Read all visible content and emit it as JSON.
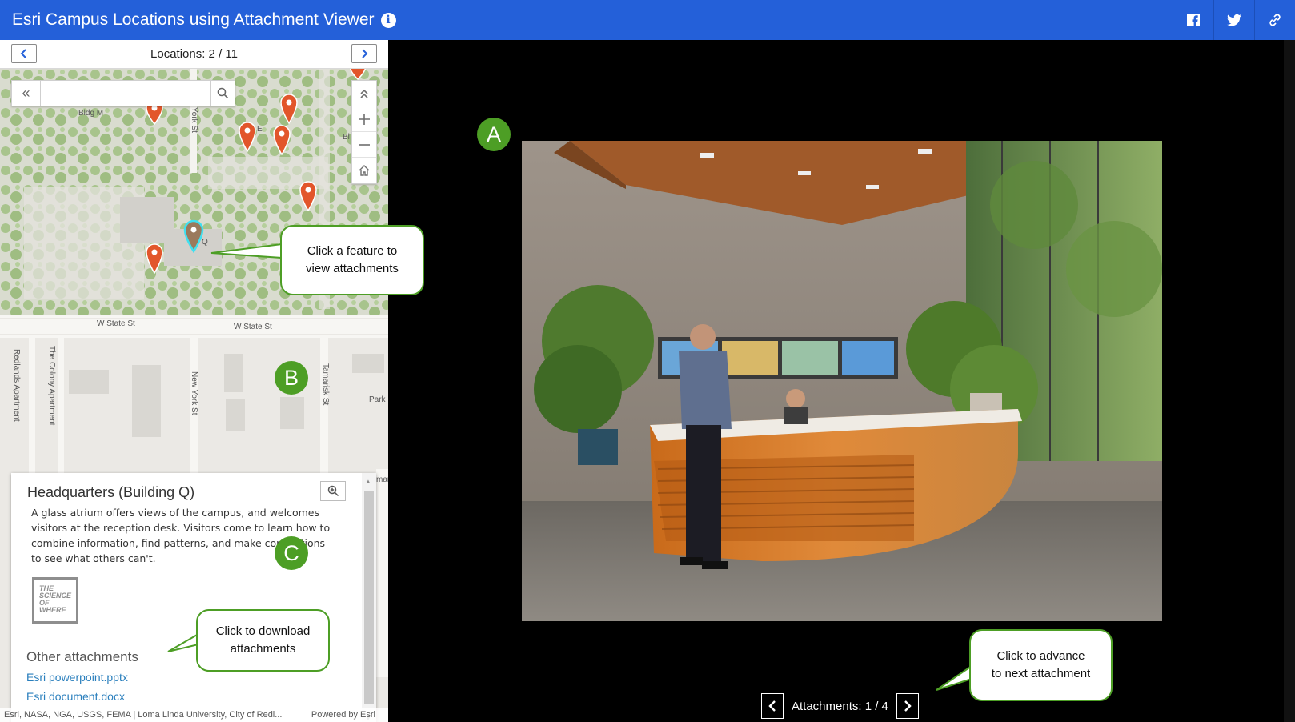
{
  "header": {
    "title": "Esri Campus Locations using Attachment Viewer",
    "bg_color": "#2460d9",
    "share_icons": [
      "facebook-icon",
      "twitter-icon",
      "link-icon"
    ]
  },
  "locations": {
    "label": "Locations: 2 / 11"
  },
  "map": {
    "search_placeholder": "",
    "labels": {
      "bldg_m": "Bldg M",
      "york_st": "York St",
      "bldg_e": "E",
      "bldg_bl": "Bl",
      "bldg_q": "Q",
      "w_state_1": "W State St",
      "w_state_2": "W State St",
      "redlands_apts": "Redlands Apartment",
      "colony_apts": "The Colony Apartment",
      "new_york_st": "New York St",
      "tamarisk_st": "Tamarisk St",
      "park": "Park",
      "mar": "mar"
    },
    "attribution": "Esri, NASA, NGA, USGS, FEMA | Loma Linda University, City of Redl...",
    "powered": "Powered by Esri"
  },
  "popup": {
    "title": "Headquarters (Building Q)",
    "description": "A glass atrium offers views of the campus, and welcomes visitors at the reception desk. Visitors come to learn how to combine information, find patterns, and make connections to see what others can't.",
    "logo_text": [
      "THE",
      "SCIENCE",
      "OF",
      "WHERE"
    ],
    "other_attachments_heading": "Other attachments",
    "attachments": [
      "Esri powerpoint.pptx",
      "Esri document.docx"
    ]
  },
  "viewer": {
    "attachments_label": "Attachments: 1 / 4"
  },
  "annotations": {
    "marker_a": "A",
    "marker_b": "B",
    "marker_c": "C",
    "callout_feature": [
      "Click a feature to",
      "view attachments"
    ],
    "callout_download": [
      "Click to download",
      "attachments"
    ],
    "callout_advance": [
      "Click to advance",
      "to next attachment"
    ],
    "color": "#4d9e25"
  }
}
